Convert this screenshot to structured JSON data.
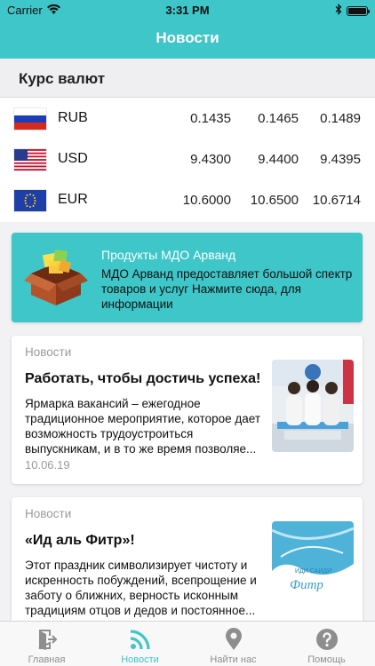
{
  "status_bar": {
    "carrier": "Carrier",
    "time": "3:31 PM"
  },
  "nav": {
    "title": "Новости"
  },
  "rates_section": {
    "title": "Курс валют",
    "rows": [
      {
        "code": "RUB",
        "flag": "russia-flag-icon",
        "values": [
          "0.1435",
          "0.1465",
          "0.1489"
        ]
      },
      {
        "code": "USD",
        "flag": "usa-flag-icon",
        "values": [
          "9.4300",
          "9.4400",
          "9.4395"
        ]
      },
      {
        "code": "EUR",
        "flag": "eu-flag-icon",
        "values": [
          "10.6000",
          "10.6500",
          "10.6714"
        ]
      }
    ]
  },
  "promo": {
    "icon": "product-box-icon",
    "title": "Продукты МДО Арванд",
    "text": "МДО Арванд предоставляет большой спектр товаров и услуг Нажмите сюда, для информации"
  },
  "news": [
    {
      "category": "Новости",
      "title": "Работать, чтобы достичь успеха!",
      "text": "Ярмарка вакансий – ежегодное традиционное мероприятие, которое дает возможность трудоустроиться выпускникам, и в то же время позволяе...",
      "date": "10.06.19"
    },
    {
      "category": "Новости",
      "title": "«Ид аль Фитр»!",
      "text": "Этот праздник символизирует чистоту и искренность побуждений, всепрощение и заботу о ближних, верность исконным традициям отцов и дедов и постоянное...",
      "image_caption": "ИДИ САИДИ",
      "image_script": "Фитр"
    }
  ],
  "tabs": [
    {
      "label": "Главная",
      "icon": "home-exit-icon",
      "active": false
    },
    {
      "label": "Новости",
      "icon": "rss-icon",
      "active": true
    },
    {
      "label": "Найти нас",
      "icon": "location-pin-icon",
      "active": false
    },
    {
      "label": "Помощь",
      "icon": "help-icon",
      "active": false
    }
  ],
  "colors": {
    "accent": "#3ec6c9",
    "tab_inactive": "#8e8e8e"
  }
}
